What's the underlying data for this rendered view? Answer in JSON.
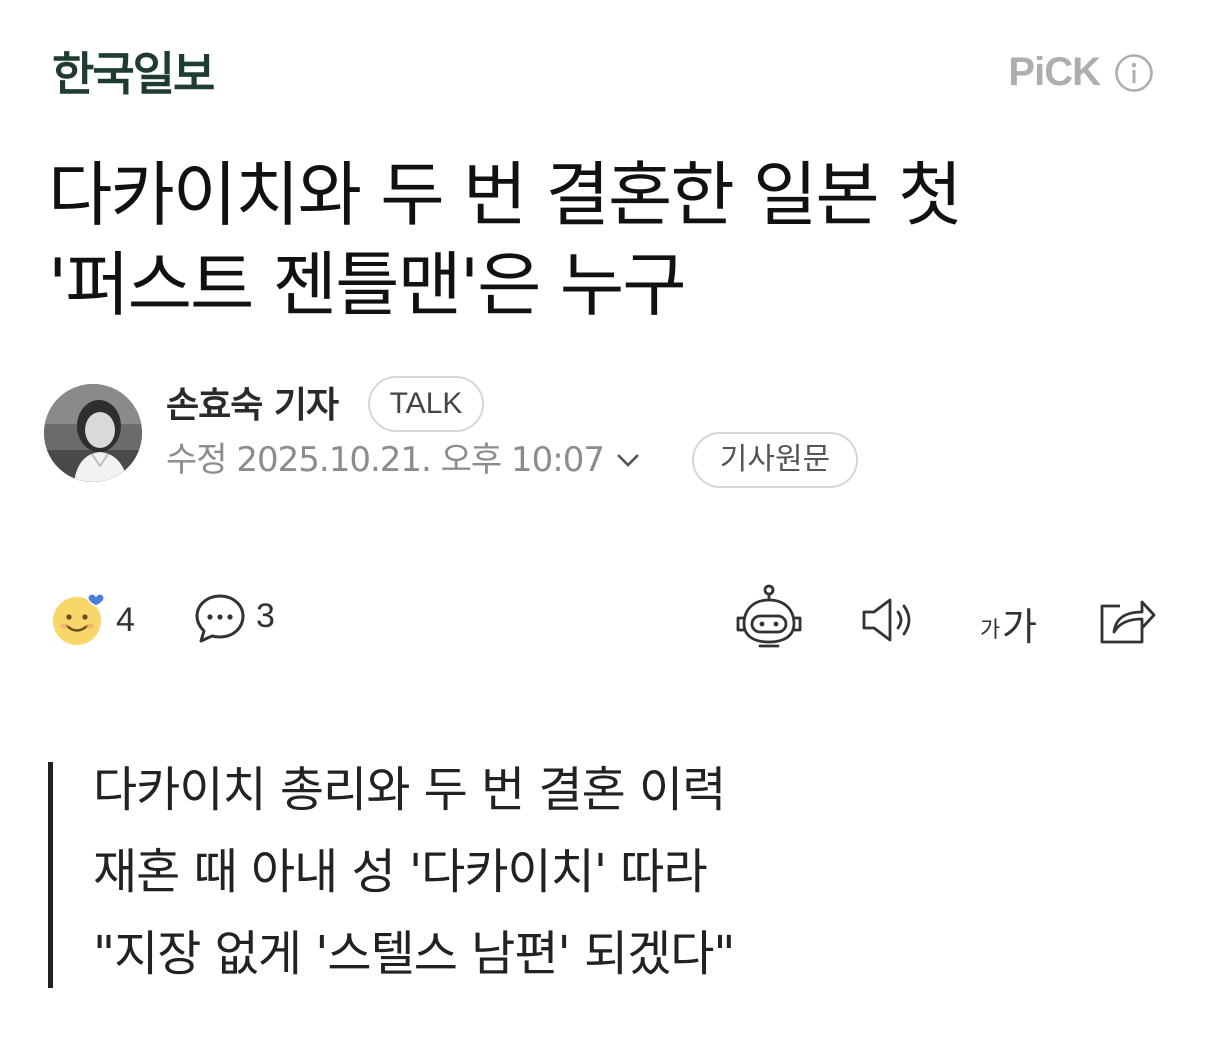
{
  "header": {
    "press_logo": "한국일보",
    "pick_label": "PiCK",
    "info_icon": "info-circle-icon"
  },
  "headline": {
    "line1": "다카이치와 두 번 결혼한 일본 첫",
    "line2": "'퍼스트 젠틀맨'은 누구"
  },
  "byline": {
    "reporter": "손효숙 기자",
    "talk_label": "TALK",
    "date_label": "수정 2025.10.21. 오후 10:07",
    "original_label": "기사원문"
  },
  "actions": {
    "reaction_count": "4",
    "comment_count": "3",
    "font_small": "가",
    "font_large": "가",
    "icons": [
      "smile-emoji-icon",
      "comment-bubble-icon",
      "robot-summary-icon",
      "speaker-icon",
      "font-size-icon",
      "share-icon"
    ]
  },
  "summary": {
    "lines": [
      "다카이치 총리와 두 번 결혼 이력",
      "재혼 때 아내 성 '다카이치' 따라",
      "\"지장 없게 '스텔스 남편' 되겠다\""
    ]
  },
  "colors": {
    "logo": "#1e3d2e",
    "pick": "#aeaeae",
    "muted_text": "#8c8c8c",
    "pill_border": "#d6d6d6",
    "emoji_yellow": "#f8d66a",
    "heart_blue": "#4a7de0"
  }
}
